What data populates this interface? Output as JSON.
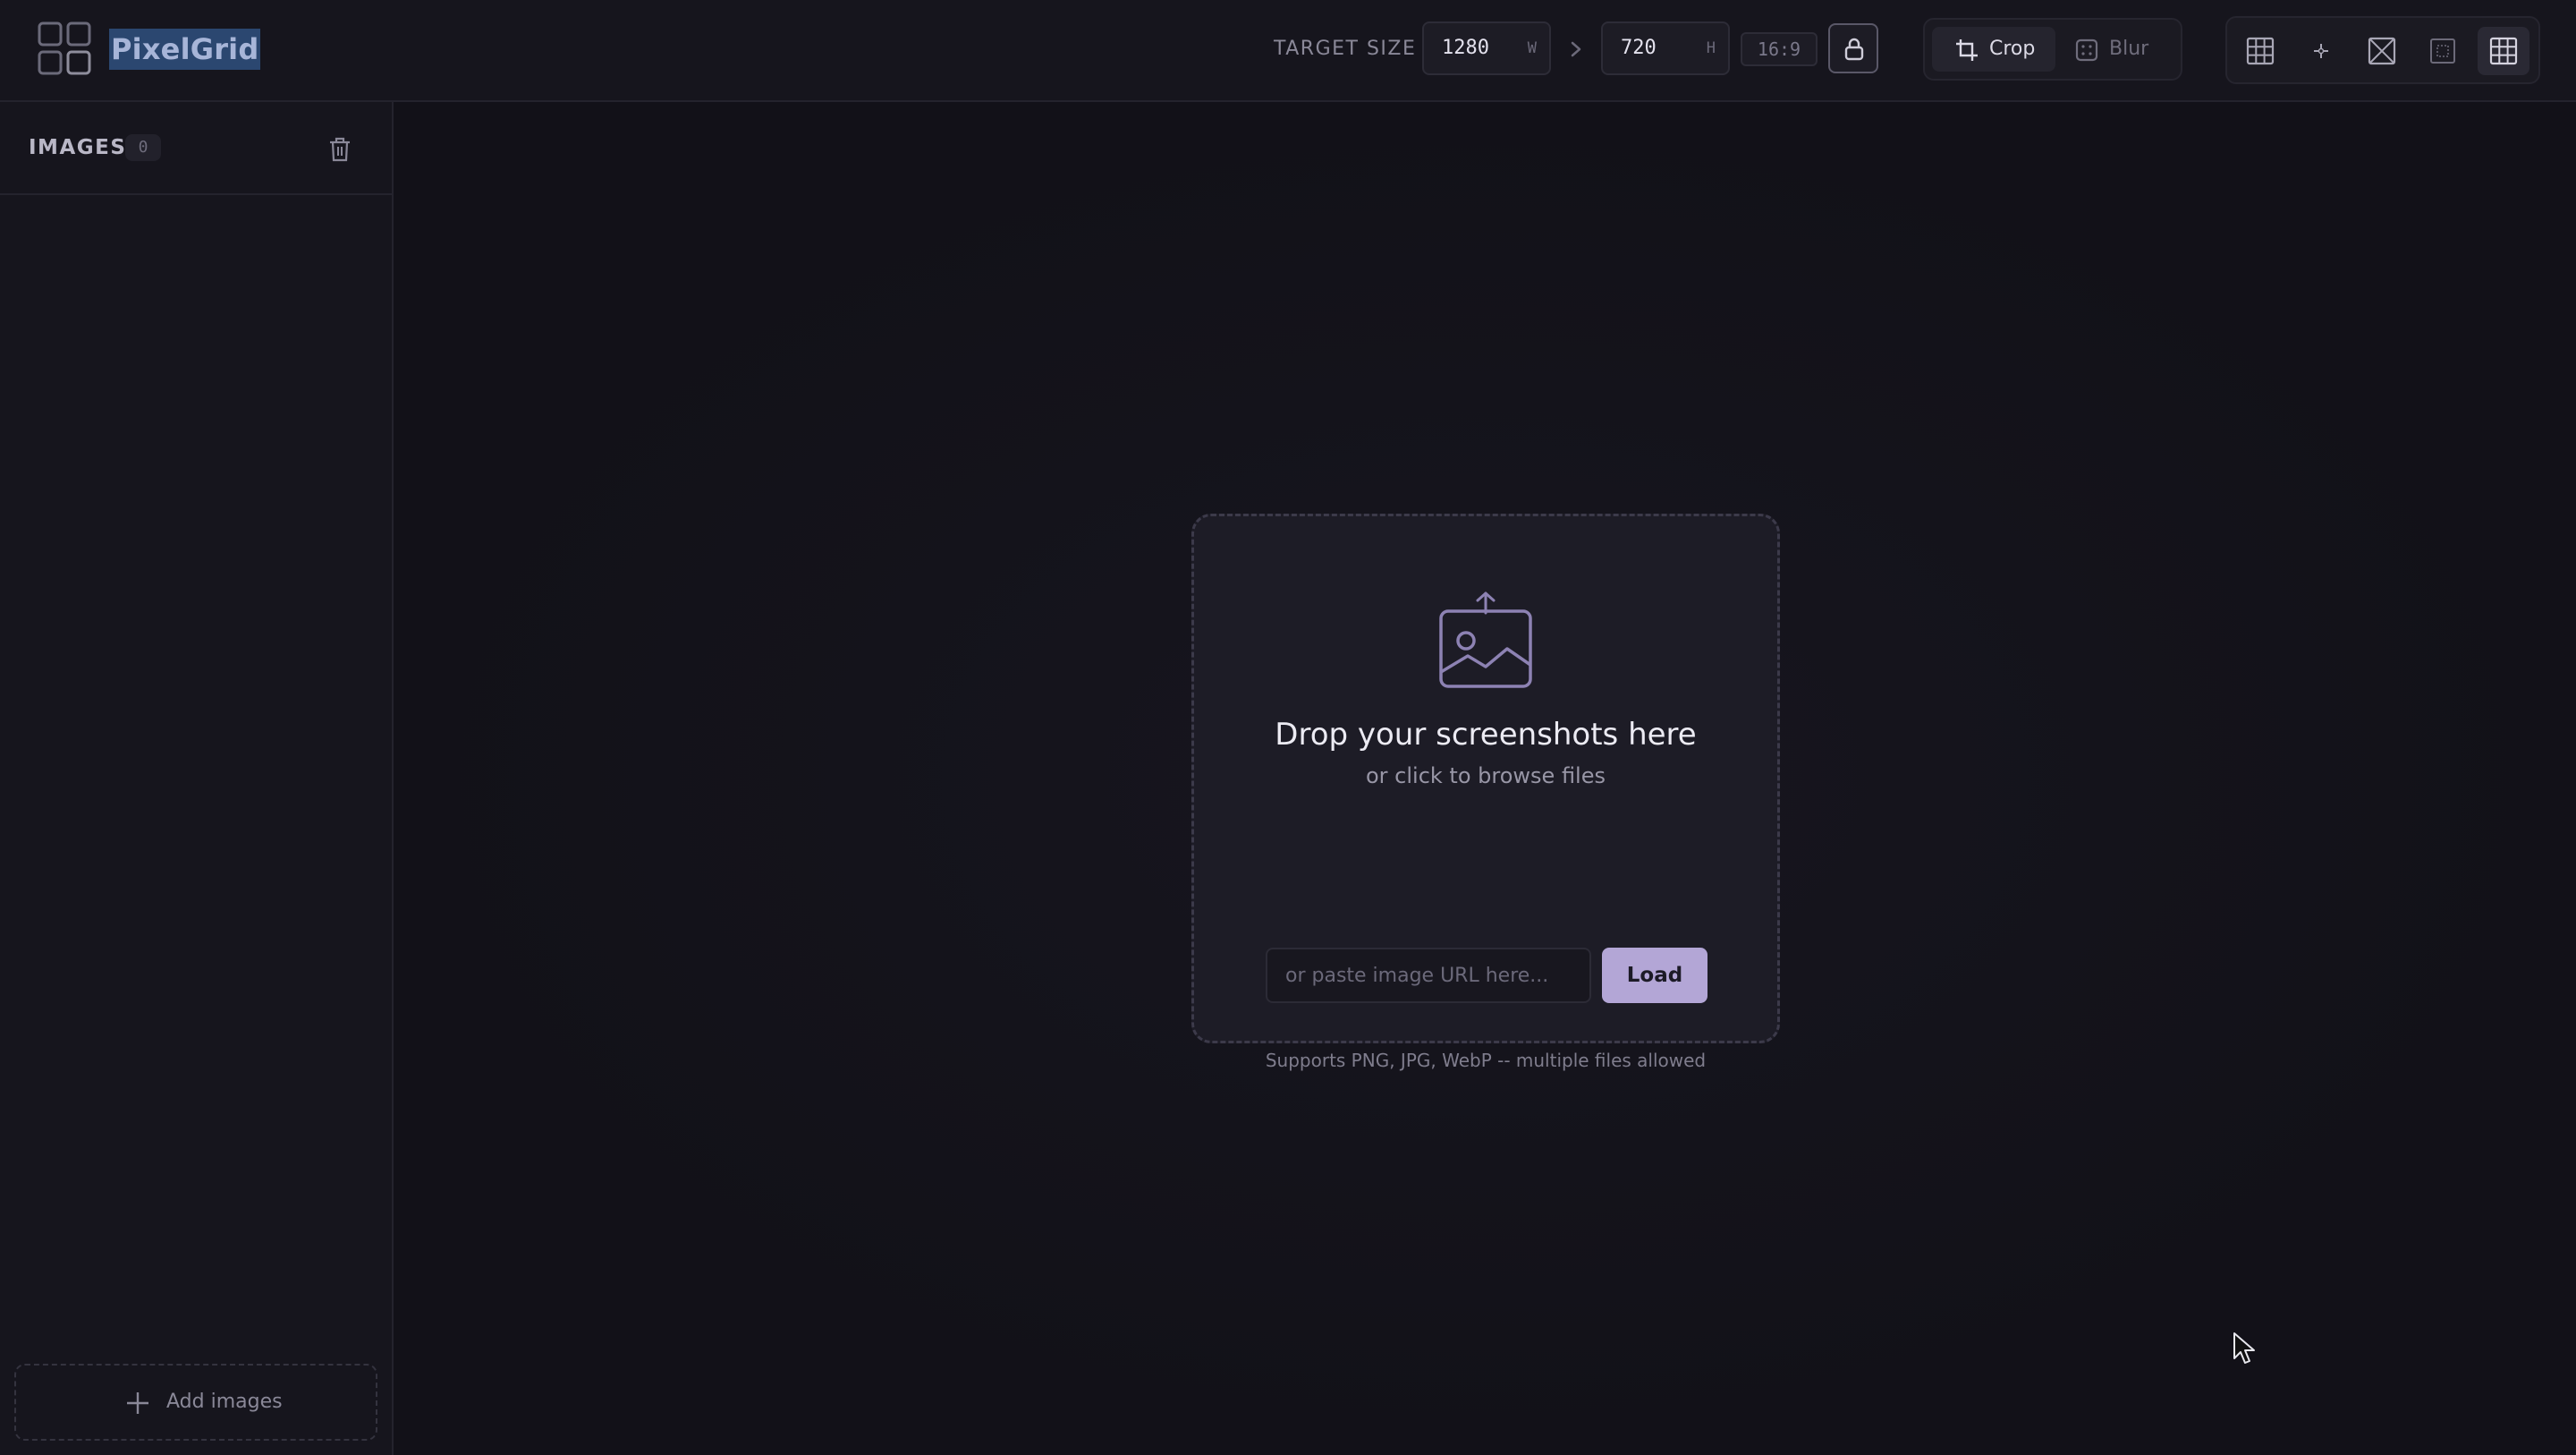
{
  "app": {
    "title": "PixelGrid"
  },
  "header": {
    "target_size_label": "TARGET SIZE",
    "width": {
      "value": "1280",
      "unit": "W"
    },
    "height": {
      "value": "720",
      "unit": "H"
    },
    "aspect_ratio": "16:9",
    "modes": [
      {
        "label": "Crop",
        "icon": "crop-icon",
        "active": true
      },
      {
        "label": "Blur",
        "icon": "blur-icon",
        "active": false
      }
    ],
    "tools": [
      "grid-icon",
      "center-point-icon",
      "cross-box-icon",
      "safe-area-icon",
      "grid-overlay-icon"
    ]
  },
  "sidebar": {
    "title": "IMAGES",
    "count": "0",
    "add_label": "Add images"
  },
  "dropzone": {
    "title": "Drop your screenshots here",
    "subtitle": "or click to browse files",
    "url_placeholder": "or paste image URL here...",
    "load_label": "Load",
    "note": "Supports PNG, JPG, WebP -- multiple files allowed"
  },
  "colors": {
    "accent": "#b3a6d6",
    "background": "#131219",
    "panel": "#16151d",
    "dropzone": "#1d1c26",
    "selection": "#2b4770"
  }
}
